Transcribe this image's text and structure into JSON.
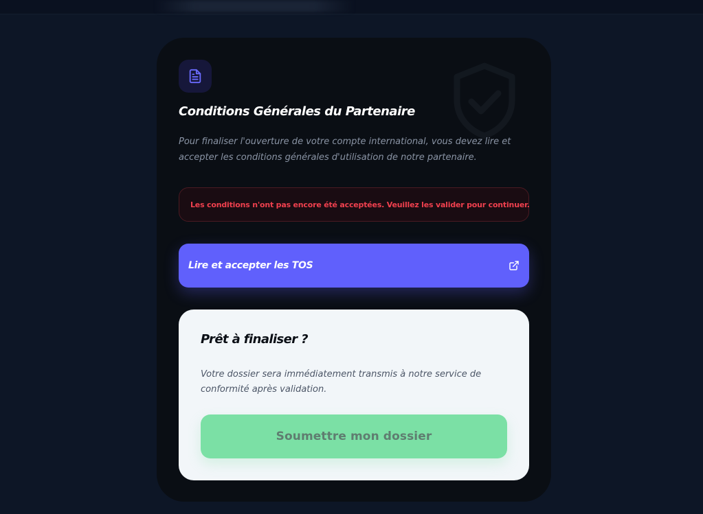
{
  "card": {
    "title": "Conditions Générales du Partenaire",
    "description": "Pour finaliser l'ouverture de votre compte international, vous devez lire et accepter les conditions générales d'utilisation de notre partenaire.",
    "doc_icon": "document-icon",
    "watermark_icon": "shield-check-icon"
  },
  "alert": {
    "message": "Les conditions n'ont pas encore été acceptées. Veuillez les valider pour continuer."
  },
  "tos_button": {
    "label": "Lire et accepter les TOS",
    "icon": "external-link-icon"
  },
  "finalize": {
    "title": "Prêt à finaliser ?",
    "description": "Votre dossier sera immédiatement transmis à notre service de conformité après validation.",
    "submit_label": "Soumettre mon dossier"
  },
  "colors": {
    "background": "#0d1626",
    "card": "#0a0e14",
    "accent": "#6060fc",
    "alert_text": "#f0404e",
    "submit": "#7be0a5"
  }
}
